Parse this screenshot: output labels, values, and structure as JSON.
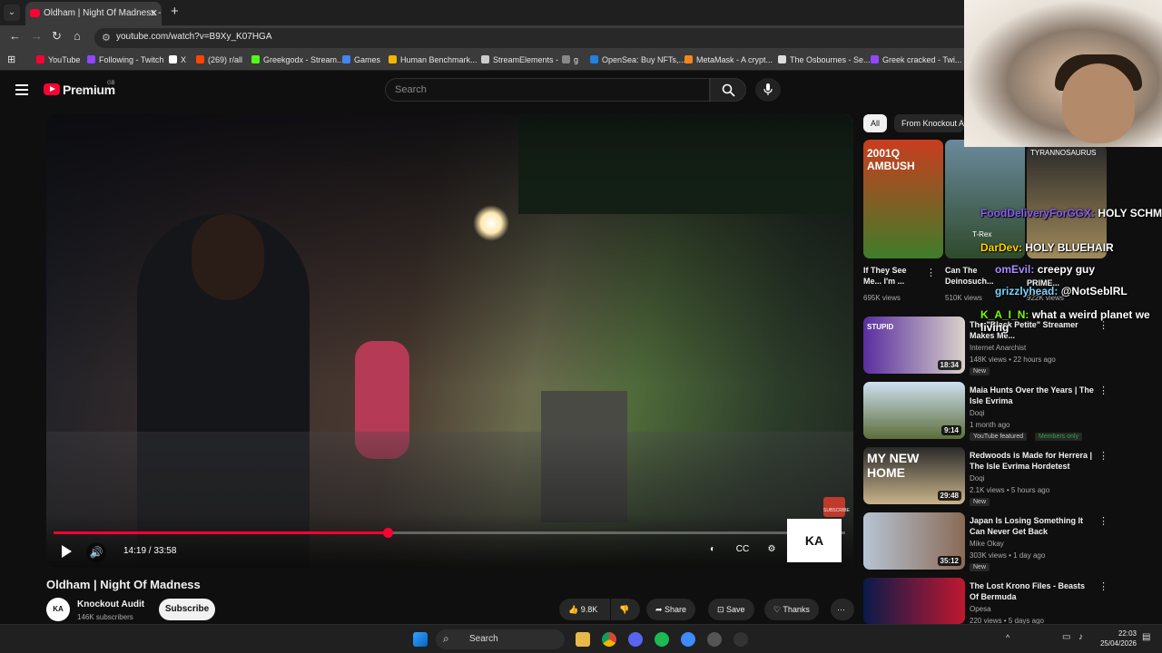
{
  "browser": {
    "tab_title": "Oldham | Night Of Madness - Y",
    "url": "youtube.com/watch?v=B9Xy_K07HGA",
    "bookmarks": [
      {
        "label": "YouTube",
        "color": "#ff0033"
      },
      {
        "label": "Following - Twitch",
        "color": "#9146ff"
      },
      {
        "label": "X",
        "color": "#ffffff"
      },
      {
        "label": "(269) r/all",
        "color": "#ff4500"
      },
      {
        "label": "Greekgodx - Stream...",
        "color": "#53fc18"
      },
      {
        "label": "Games",
        "color": "#4285f4"
      },
      {
        "label": "Human Benchmark...",
        "color": "#f4b400"
      },
      {
        "label": "StreamElements -",
        "color": "#cccccc"
      },
      {
        "label": "g",
        "color": "#888888"
      },
      {
        "label": "OpenSea: Buy NFTs,...",
        "color": "#2081e2"
      },
      {
        "label": "MetaMask - A crypt...",
        "color": "#f6851b"
      },
      {
        "label": "The Osbournes - Se...",
        "color": "#dddddd"
      },
      {
        "label": "Greek cracked - Twi...",
        "color": "#9146ff"
      }
    ]
  },
  "header": {
    "logo_text": "Premium",
    "region": "GB",
    "search_placeholder": "Search"
  },
  "player": {
    "time": "14:19 / 33:58",
    "progress": 0.4215,
    "watermark": "KA"
  },
  "video": {
    "title": "Oldham | Night Of Madness",
    "channel": "Knockout Audit",
    "channel_initials": "KA",
    "subscribers": "146K subscribers",
    "subscribe_label": "Subscribe",
    "likes": "9.8K",
    "share": "Share",
    "save": "Save",
    "thanks": "Thanks"
  },
  "chips": [
    "All",
    "From Knockout A"
  ],
  "top_recs": [
    {
      "title": "If They See Me... I'm ...",
      "views": "695K views",
      "thumb_text": "2001Q AMBUSH"
    },
    {
      "title": "Can The Deinosuch...",
      "views": "510K views",
      "thumb_text": "T-Rex"
    },
    {
      "title": "PRIME...",
      "views": "922K views",
      "thumb_text": "TYRANNOSAURUS"
    }
  ],
  "recs": [
    {
      "title": "The \"Black Petite\" Streamer Makes Me...",
      "channel": "Internet Anarchist",
      "meta": "148K views • 22 hours ago",
      "duration": "18:34",
      "badge": "New",
      "thumb_text": "STUPID"
    },
    {
      "title": "Maia Hunts Over the Years | The Isle Evrima",
      "channel": "Doqi",
      "meta": "1 month ago",
      "duration": "9:14",
      "badge": "YouTube featured",
      "badge2": "Members only"
    },
    {
      "title": "Redwoods is Made for Herrera | The Isle Evrima Hordetest",
      "channel": "Doqi",
      "meta": "2.1K views • 5 hours ago",
      "duration": "29:48",
      "badge": "New",
      "thumb_text": "MY NEW HOME"
    },
    {
      "title": "Japan Is Losing Something It Can Never Get Back",
      "channel": "Mike Okay",
      "meta": "303K views • 1 day ago",
      "duration": "35:12",
      "badge": "New"
    },
    {
      "title": "The Lost Krono Files - Beasts Of Bermuda",
      "channel": "Opesa",
      "meta": "220 views • 5 days ago",
      "duration": ""
    }
  ],
  "chat": [
    {
      "user": "FoodDeliveryForGGX:",
      "msg": "HOLY SCHMOLY"
    },
    {
      "user": "DarDev:",
      "msg": "HOLY BLUEHAIR"
    },
    {
      "user": "omEvil:",
      "msg": "creepy guy"
    },
    {
      "user": "grizzlyhead:",
      "msg": "@NotSeblRL"
    },
    {
      "user": "K_A_I_N:",
      "msg": "what a weird planet we living"
    }
  ],
  "taskbar": {
    "search": "Search",
    "time": "22:03",
    "date": "25/04/2026"
  }
}
